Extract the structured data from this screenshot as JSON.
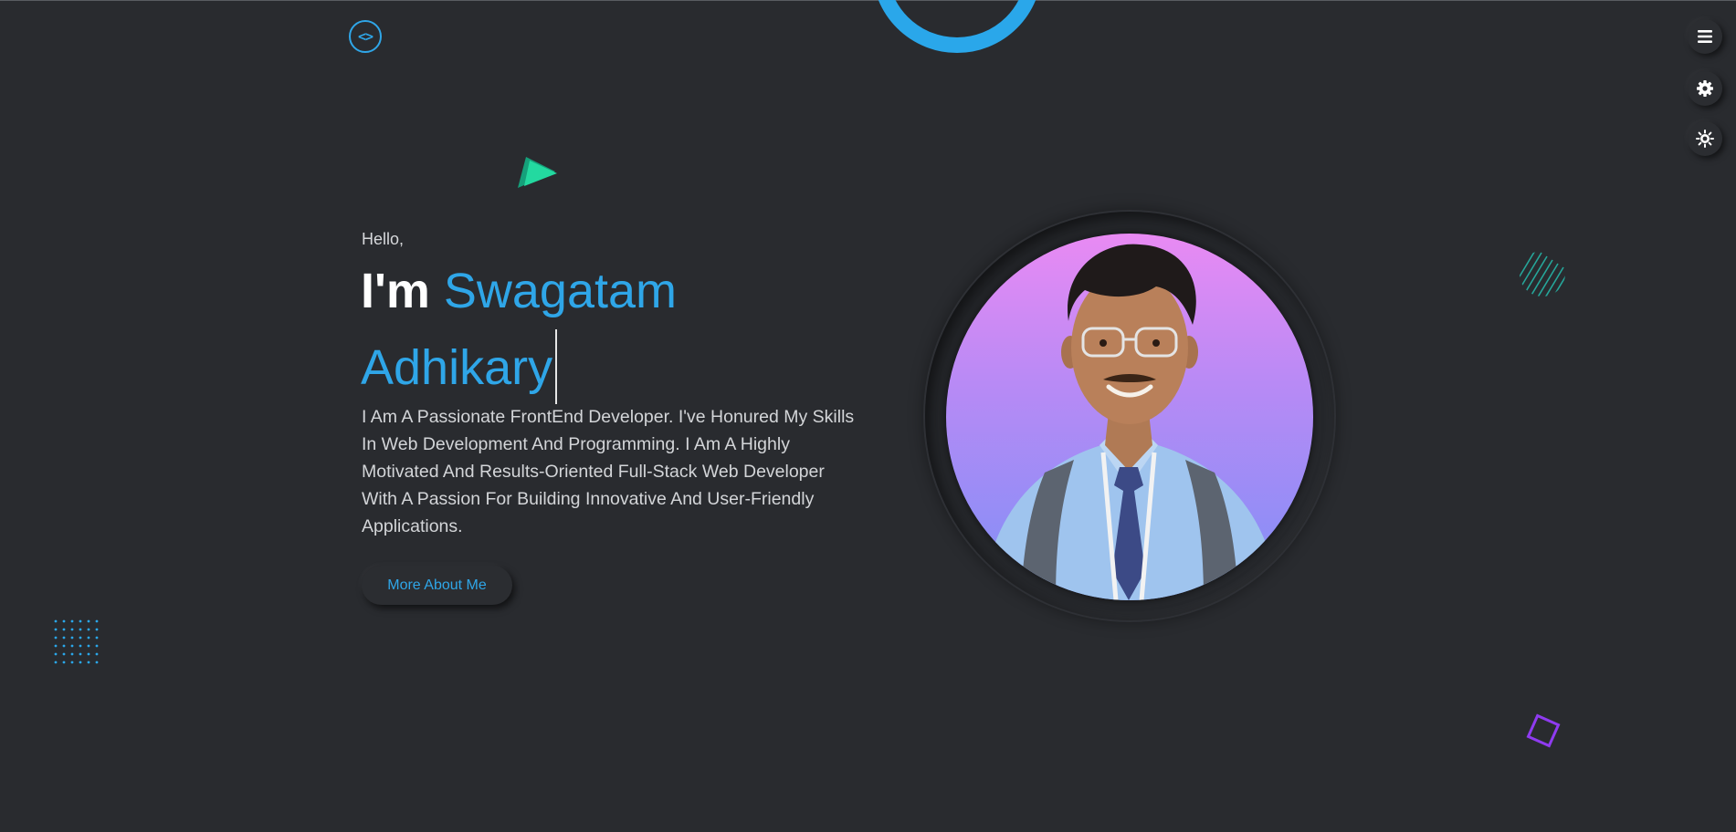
{
  "logo": {
    "glyph": "<>",
    "icon": "code-brackets-icon"
  },
  "controls": [
    {
      "name": "menu-button",
      "icon": "hamburger-icon"
    },
    {
      "name": "settings-button",
      "icon": "gear-icon"
    },
    {
      "name": "theme-button",
      "icon": "sun-icon"
    }
  ],
  "hero": {
    "greeting": "Hello,",
    "prefix": "I'm",
    "name": "Swagatam Adhikary",
    "description": "I Am A Passionate FrontEnd Developer. I've Honured My Skills In Web Development And Programming. I Am A Highly Motivated And Results-Oriented Full-Stack Web Developer With A Passion For Building Innovative And User-Friendly Applications.",
    "button_label": "More About Me"
  },
  "colors": {
    "background": "#292b2f",
    "accent": "#2fa6e8",
    "heading": "#ffffff",
    "triangle": "#1fd39b",
    "square": "#8f3bf0"
  }
}
